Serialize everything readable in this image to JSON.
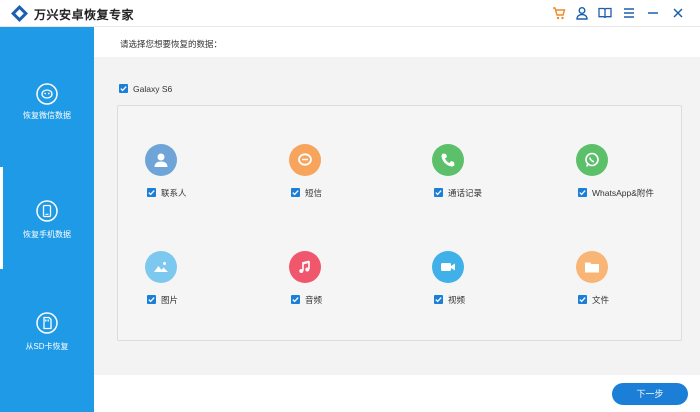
{
  "app": {
    "title": "万兴安卓恢复专家"
  },
  "colors": {
    "accent": "#1b7fd8",
    "sidebar": "#1e9ae6",
    "toolbar_cart": "#f08a24"
  },
  "toolbar_icons": [
    "cart-icon",
    "user-icon",
    "book-icon",
    "menu-icon",
    "minimize-icon",
    "close-icon"
  ],
  "sidebar": {
    "items": [
      {
        "label": "恢复微信数据",
        "icon": "wechat-recover-icon",
        "active": false
      },
      {
        "label": "恢复手机数据",
        "icon": "phone-recover-icon",
        "active": true
      },
      {
        "label": "从SD卡恢复",
        "icon": "sdcard-recover-icon",
        "active": false
      }
    ]
  },
  "main": {
    "prompt": "请选择您想要恢复的数据：",
    "device": {
      "label": "Galaxy S6",
      "checked": true
    },
    "categories": [
      {
        "label": "联系人",
        "icon": "contacts-icon",
        "color": "#6fa4d8",
        "checked": true
      },
      {
        "label": "短信",
        "icon": "messages-icon",
        "color": "#f7a45c",
        "checked": true
      },
      {
        "label": "通话记录",
        "icon": "call-log-icon",
        "color": "#5cc06a",
        "checked": true
      },
      {
        "label": "WhatsApp&附件",
        "icon": "whatsapp-icon",
        "color": "#5cc06a",
        "checked": true
      },
      {
        "label": "图片",
        "icon": "photos-icon",
        "color": "#7dc8ef",
        "checked": true
      },
      {
        "label": "音频",
        "icon": "audio-icon",
        "color": "#f0566c",
        "checked": true
      },
      {
        "label": "视频",
        "icon": "video-icon",
        "color": "#3fb1e8",
        "checked": true
      },
      {
        "label": "文件",
        "icon": "files-icon",
        "color": "#f8b575",
        "checked": true
      }
    ]
  },
  "footer": {
    "next_label": "下一步"
  }
}
